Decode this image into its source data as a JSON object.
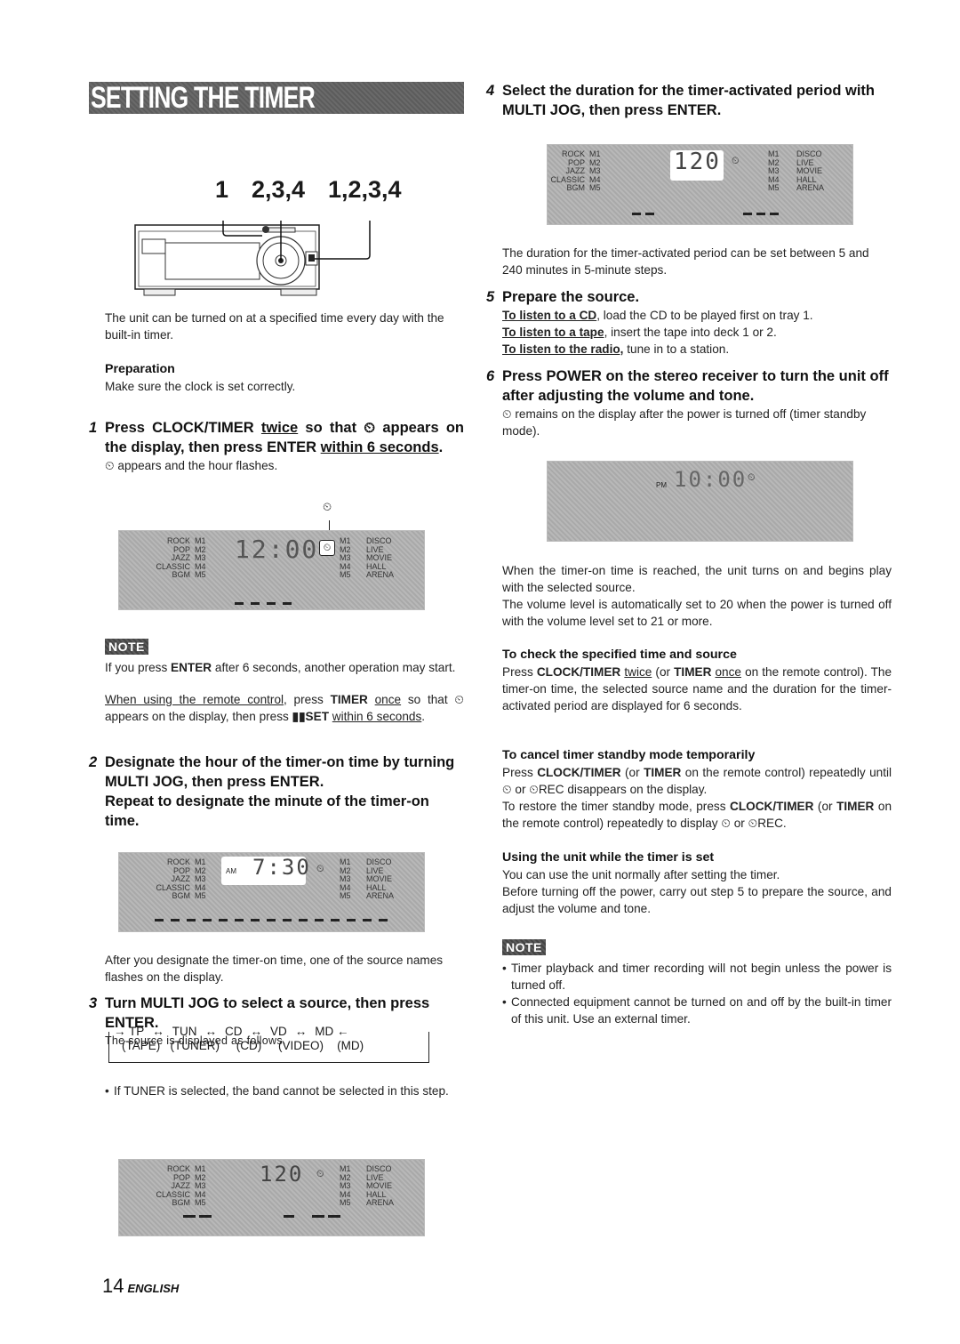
{
  "header": {
    "title": "SETTING THE TIMER"
  },
  "figure_callouts": {
    "label_1": "1",
    "label_2": "2,3,4",
    "label_3": "1,2,3,4"
  },
  "intro": "The unit can be turned on at a specified time every day with the built-in timer.",
  "preparation": {
    "heading": "Preparation",
    "text": "Make sure the clock is set correctly."
  },
  "step1": {
    "num": "1",
    "head_a": "Press CLOCK/TIMER ",
    "head_twice": "twice",
    "head_b": " so that ",
    "head_c": " appears on the display, then press ENTER ",
    "head_within": "within 6 seconds",
    "head_d": ".",
    "sub": " appears and the hour flashes."
  },
  "lcd": {
    "left_names": [
      "ROCK",
      "POP",
      "JAZZ",
      "CLASSIC",
      "BGM"
    ],
    "memories": [
      "M1",
      "M2",
      "M3",
      "M4",
      "M5"
    ],
    "right_names": [
      "DISCO",
      "LIVE",
      "MOVIE",
      "HALL",
      "ARENA"
    ],
    "display1_digits": "12:00",
    "display2_ampm": "AM",
    "display2_digits": "7:30",
    "display3_digits": "120",
    "display4_digits": "120",
    "display5_ampm": "PM",
    "display5_digits": "10:00"
  },
  "note1": {
    "badge": "NOTE",
    "p1_a": "If you press ",
    "p1_b": "ENTER",
    "p1_c": " after 6 seconds, another operation may start.",
    "p2_a": "When using the remote control",
    "p2_b": ", press ",
    "p2_c": "TIMER",
    "p2_d": " ",
    "p2_e": "once",
    "p2_f": " so that ",
    "p2_g": " appears on the display, then press ",
    "p2_h": "▮▮SET",
    "p2_i": " ",
    "p2_j": "within 6 seconds",
    "p2_k": "."
  },
  "step2": {
    "num": "2",
    "head1": "Designate the hour of the timer-on time by turning MULTI JOG, then press ENTER.",
    "head2": "Repeat to designate the minute of the timer-on time.",
    "after": "After you designate the timer-on time, one of the source names flashes on the display."
  },
  "step3": {
    "num": "3",
    "head": "Turn MULTI JOG to select a source, then press ENTER.",
    "sub": "The source is displayed as follows.",
    "sources": [
      {
        "code": "TP",
        "name": "(TAPE)"
      },
      {
        "code": "TUN",
        "name": "(TUNER)"
      },
      {
        "code": "CD",
        "name": "(CD)"
      },
      {
        "code": "VD",
        "name": "(VIDEO)"
      },
      {
        "code": "MD",
        "name": "(MD)"
      }
    ],
    "arrow": "↔",
    "bullet": "If TUNER is selected, the band cannot be selected in this step."
  },
  "step4": {
    "num": "4",
    "head": "Select the duration for the timer-activated period with MULTI JOG, then press ENTER.",
    "text": "The duration for the timer-activated period can be set between 5 and 240 minutes in 5-minute steps."
  },
  "step5": {
    "num": "5",
    "head": "Prepare the source.",
    "lines": [
      {
        "lead": "To listen to a CD",
        "rest": ", load the CD to be played first on tray 1."
      },
      {
        "lead": "To listen to a tape",
        "rest": ", insert the tape into deck 1 or 2."
      },
      {
        "lead": "To listen to the radio,",
        "rest": " tune in to a station."
      }
    ]
  },
  "step6": {
    "num": "6",
    "head": "Press POWER on the stereo receiver to turn the unit off after adjusting the volume and tone.",
    "sub": " remains on the display after the power is turned off (timer standby mode).",
    "after1": "When the timer-on time is reached, the unit turns on and begins play with the selected source.",
    "after2": "The volume level is automatically set to 20 when the power is turned off with the volume level set to 21 or more."
  },
  "check": {
    "heading": "To check the specified time and source",
    "a": "Press ",
    "b": "CLOCK/TIMER",
    "c": " ",
    "d": "twice",
    "e": " (or ",
    "f": "TIMER",
    "g": " ",
    "h": "once",
    "i": " on the remote control). The timer-on time, the selected source name and the duration for the timer-activated period are displayed for 6 seconds."
  },
  "cancel": {
    "heading": "To cancel timer standby mode temporarily",
    "p1_a": "Press ",
    "p1_b": "CLOCK/TIMER",
    "p1_c": " (or ",
    "p1_d": "TIMER",
    "p1_e": " on the remote control) repeatedly until ",
    "p1_f": " or ",
    "p1_g": "REC disappears on the display.",
    "p2_a": "To restore the timer standby mode, press ",
    "p2_b": "CLOCK/TIMER",
    "p2_c": " (or ",
    "p2_d": "TIMER",
    "p2_e": " on the remote control) repeatedly to display ",
    "p2_f": " or ",
    "p2_g": "REC."
  },
  "using": {
    "heading": "Using the unit while the timer is set",
    "p1": "You can use the unit normally after setting the timer.",
    "p2": "Before turning off the power, carry out step 5 to prepare the source, and adjust the volume and tone."
  },
  "note2": {
    "badge": "NOTE",
    "bullets": [
      "Timer playback and timer recording will not begin unless the power is turned off.",
      "Connected equipment cannot be turned on and off by the built-in timer of this unit.  Use an external timer."
    ]
  },
  "icons": {
    "timer": "⏲"
  },
  "footer": {
    "page": "14",
    "language": "ENGLISH"
  }
}
